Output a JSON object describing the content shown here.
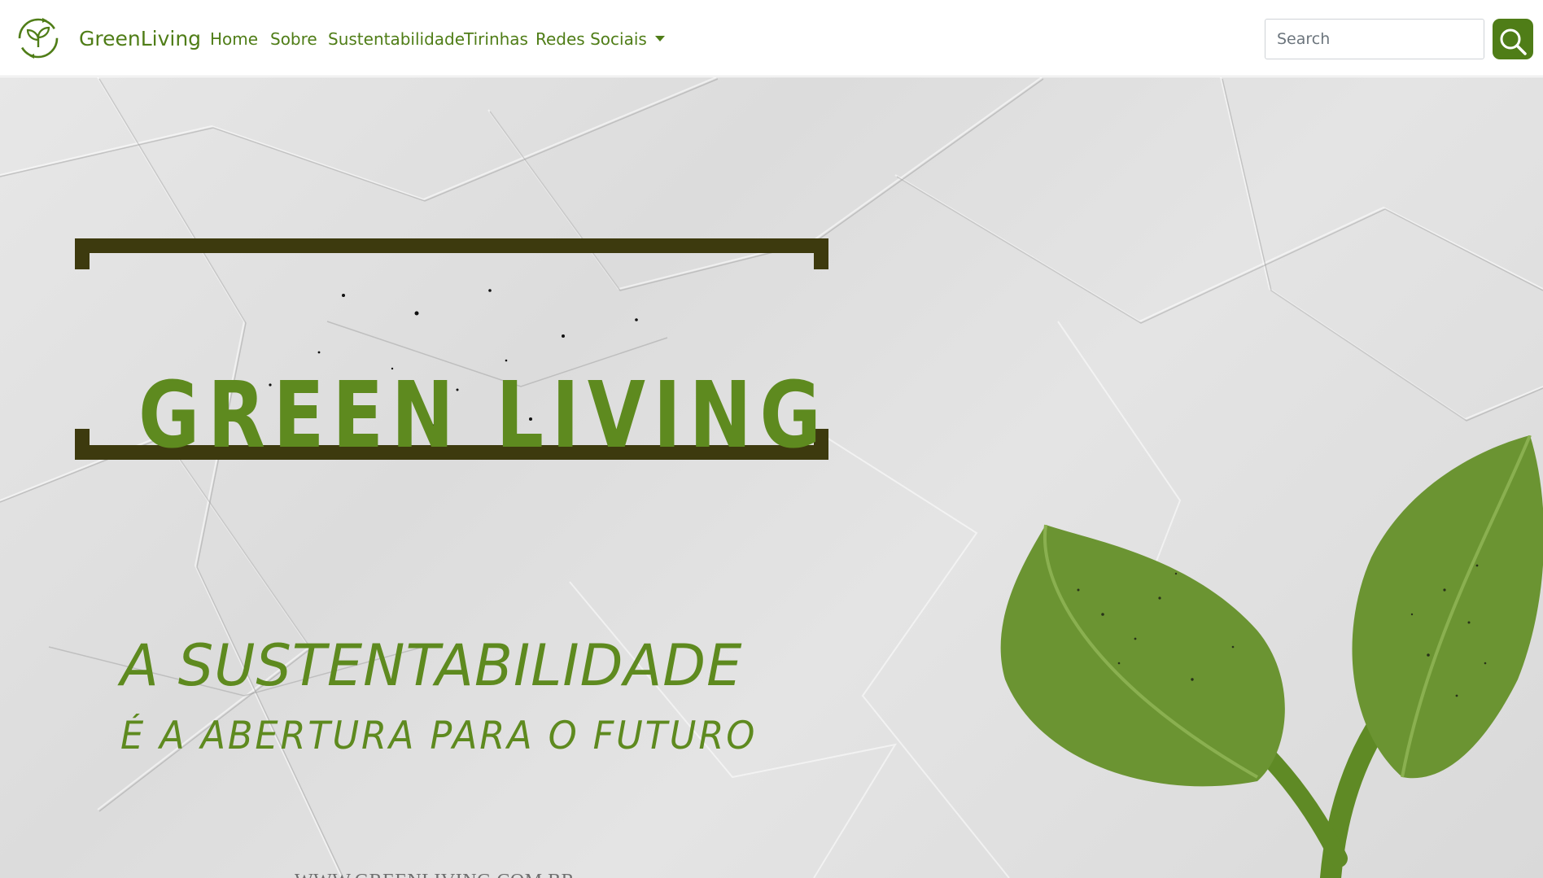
{
  "navbar": {
    "brand": {
      "logo_icon": "recycle-leaf-logo",
      "name": "GreenLiving"
    },
    "links": [
      {
        "label": "Home"
      },
      {
        "label": "Sobre"
      },
      {
        "label": "Sustentabilidade"
      },
      {
        "label": "Tirinhas"
      },
      {
        "label": "Redes Sociais",
        "dropdown": true
      }
    ],
    "search": {
      "placeholder": "Search",
      "value": "",
      "button_icon": "search-icon"
    }
  },
  "hero": {
    "title": "GREEN LIVING",
    "tagline_line1": "A SUSTENTABILIDADE",
    "tagline_line2": "É A ABERTURA PARA O FUTURO",
    "url": "WWW.GREENLIVING.COM.BR",
    "decoration_icon": "leaves-icon"
  },
  "colors": {
    "brand_green": "#4f7d17",
    "title_green": "#5e8a1f",
    "leaf_green": "#6b9432",
    "frame_dark": "#3d3a0e"
  }
}
